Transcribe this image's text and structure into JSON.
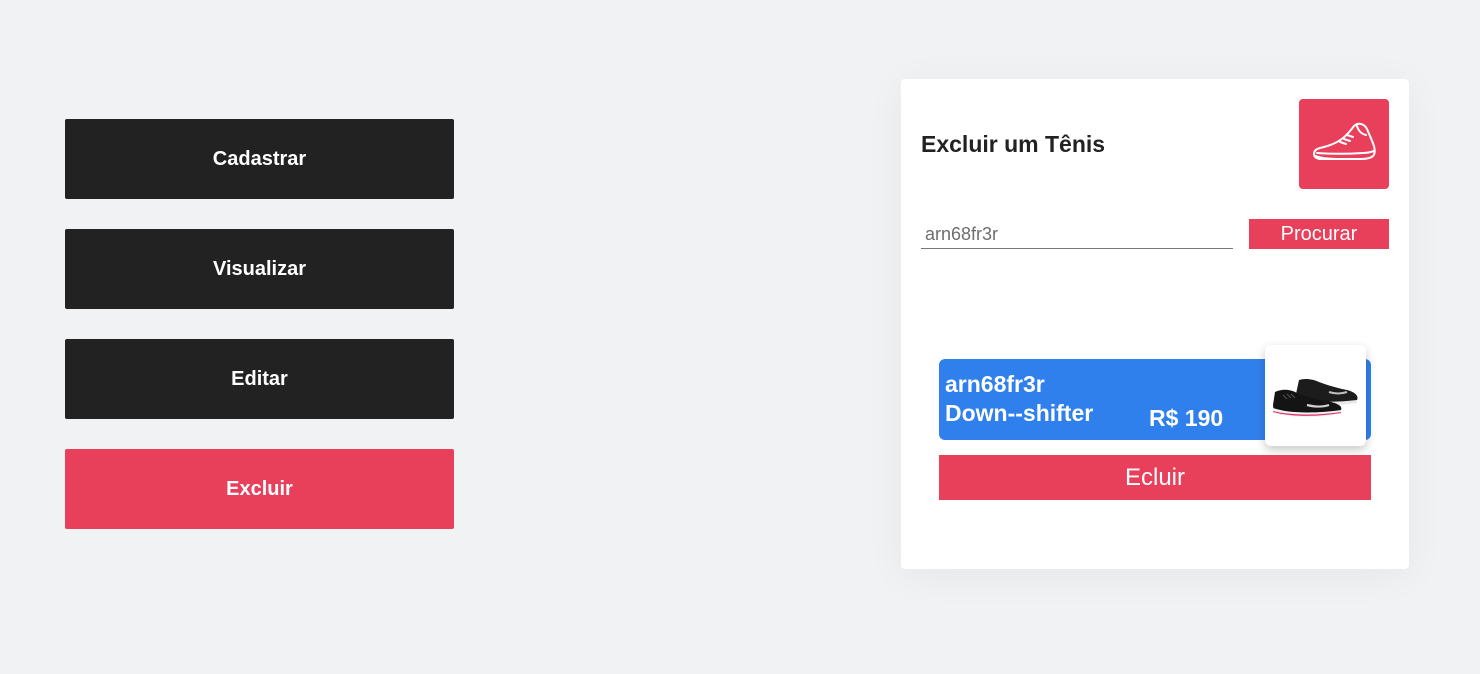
{
  "menu": {
    "items": [
      {
        "label": "Cadastrar",
        "active": false
      },
      {
        "label": "Visualizar",
        "active": false
      },
      {
        "label": "Editar",
        "active": false
      },
      {
        "label": "Excluir",
        "active": true
      }
    ]
  },
  "panel": {
    "title": "Excluir um Tênis",
    "logo_icon": "sneaker-icon",
    "search": {
      "value": "arn68fr3r",
      "button_label": "Procurar"
    },
    "product": {
      "code": "arn68fr3r",
      "name": "Down--shifter",
      "price": "R$ 190",
      "image_icon": "shoe-photo"
    },
    "delete_label": "Ecluir"
  },
  "colors": {
    "accent": "#e83f5b",
    "dark": "#222222",
    "card": "#2f80ed",
    "background": "#f1f2f4"
  }
}
